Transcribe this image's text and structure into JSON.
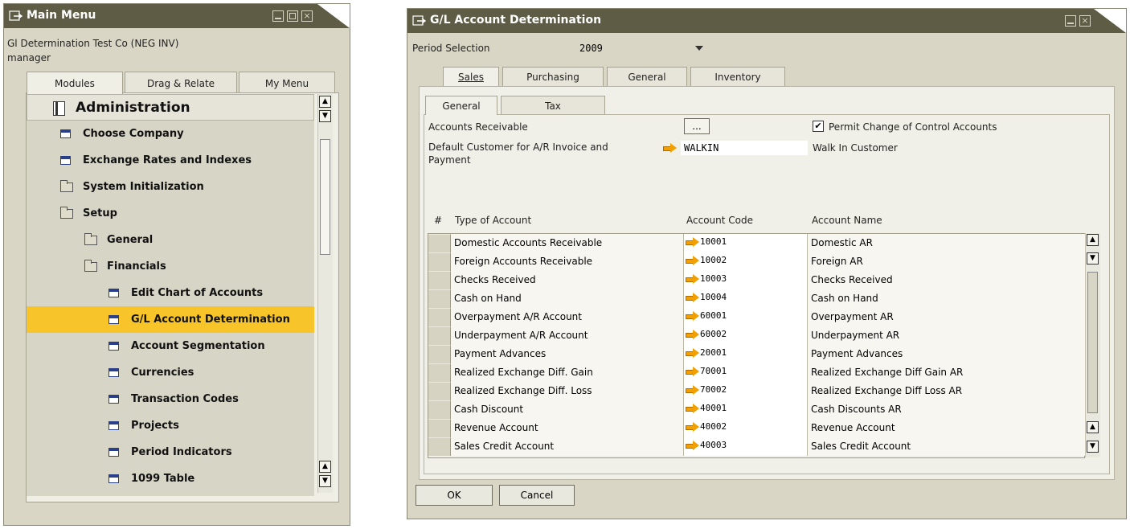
{
  "main_menu": {
    "title": "Main Menu",
    "company": "Gl Determination Test Co (NEG INV)",
    "user": "manager",
    "tabs": [
      "Modules",
      "Drag & Relate",
      "My Menu"
    ],
    "header": "Administration",
    "items": [
      {
        "label": "Choose Company",
        "icon": "form-icon"
      },
      {
        "label": "Exchange Rates and Indexes",
        "icon": "form-icon"
      },
      {
        "label": "System Initialization",
        "icon": "folder-icon"
      },
      {
        "label": "Setup",
        "icon": "folder-open-icon"
      },
      {
        "label": "General",
        "icon": "folder-icon"
      },
      {
        "label": "Financials",
        "icon": "folder-open-icon"
      },
      {
        "label": "Edit Chart of Accounts",
        "icon": "form-icon"
      },
      {
        "label": "G/L Account Determination",
        "icon": "form-icon",
        "selected": true
      },
      {
        "label": "Account Segmentation",
        "icon": "form-icon"
      },
      {
        "label": "Currencies",
        "icon": "form-icon"
      },
      {
        "label": "Transaction Codes",
        "icon": "form-icon"
      },
      {
        "label": "Projects",
        "icon": "form-icon"
      },
      {
        "label": "Period Indicators",
        "icon": "form-icon"
      },
      {
        "label": "1099 Table",
        "icon": "form-icon"
      }
    ]
  },
  "gl": {
    "title": "G/L Account Determination",
    "period_label": "Period Selection",
    "period_value": "2009",
    "tabs": [
      "Sales",
      "Purchasing",
      "General",
      "Inventory"
    ],
    "subtabs": [
      "General",
      "Tax"
    ],
    "ar_label": "Accounts Receivable",
    "ar_button": "...",
    "permit_label": "Permit Change of Control Accounts",
    "default_customer_label": "Default Customer for A/R Invoice and Payment",
    "default_customer_code": "WALKIN",
    "default_customer_name": "Walk In Customer",
    "columns": [
      "#",
      "Type of Account",
      "Account Code",
      "Account Name"
    ],
    "rows": [
      {
        "type": "Domestic Accounts Receivable",
        "code": "10001",
        "name": "Domestic AR"
      },
      {
        "type": "Foreign Accounts Receivable",
        "code": "10002",
        "name": "Foreign AR"
      },
      {
        "type": "Checks Received",
        "code": "10003",
        "name": "Checks Received"
      },
      {
        "type": "Cash on Hand",
        "code": "10004",
        "name": "Cash on Hand"
      },
      {
        "type": "Overpayment A/R Account",
        "code": "60001",
        "name": "Overpayment AR"
      },
      {
        "type": "Underpayment A/R Account",
        "code": "60002",
        "name": "Underpayment AR"
      },
      {
        "type": "Payment Advances",
        "code": "20001",
        "name": "Payment Advances"
      },
      {
        "type": "Realized Exchange Diff. Gain",
        "code": "70001",
        "name": "Realized Exchange Diff Gain AR"
      },
      {
        "type": "Realized Exchange Diff. Loss",
        "code": "70002",
        "name": "Realized Exchange Diff Loss AR"
      },
      {
        "type": "Cash Discount",
        "code": "40001",
        "name": "Cash Discounts AR"
      },
      {
        "type": "Revenue Account",
        "code": "40002",
        "name": "Revenue Account"
      },
      {
        "type": "Sales Credit Account",
        "code": "40003",
        "name": "Sales Credit Account"
      }
    ],
    "ok": "OK",
    "cancel": "Cancel"
  },
  "colors": {
    "titlebar": "#5e5c45",
    "highlight": "#f7c52a",
    "window": "#d9d6c6"
  }
}
